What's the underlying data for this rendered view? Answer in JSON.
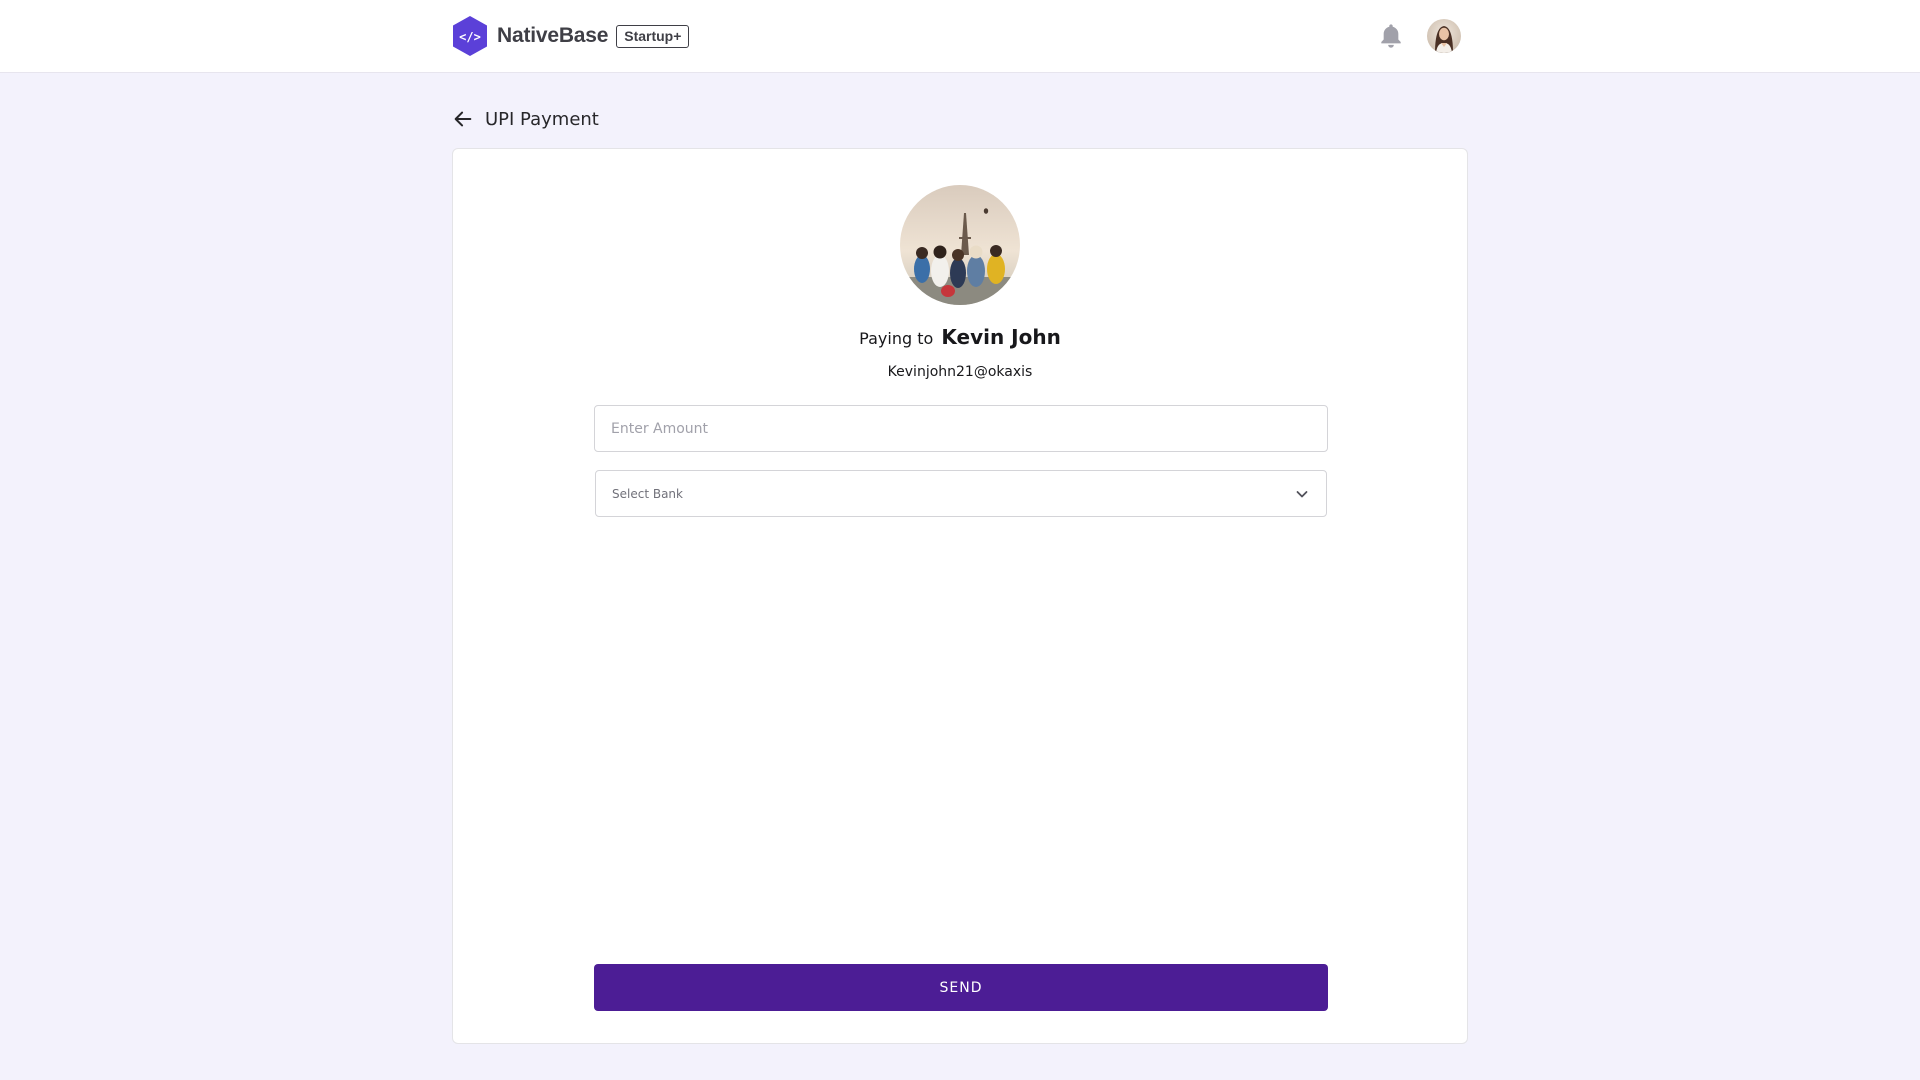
{
  "header": {
    "brand_name": "NativeBase",
    "brand_badge": "Startup+",
    "logo_glyph": "</>",
    "notification_icon": "bell-icon",
    "avatar_icon": "user-avatar"
  },
  "page": {
    "title": "UPI Payment",
    "back_icon": "arrow-left-icon"
  },
  "payment": {
    "paying_prefix": "Paying to",
    "payee_name": "Kevin John",
    "payee_upi": "Kevinjohn21@okaxis",
    "amount_value": "",
    "amount_placeholder": "Enter Amount",
    "bank_placeholder": "Select Bank",
    "send_label": "SEND"
  },
  "colors": {
    "page_background": "#f3f2fc",
    "brand_purple": "#5b40d8",
    "send_button": "#4c1d95",
    "header_background": "#ffffff"
  }
}
